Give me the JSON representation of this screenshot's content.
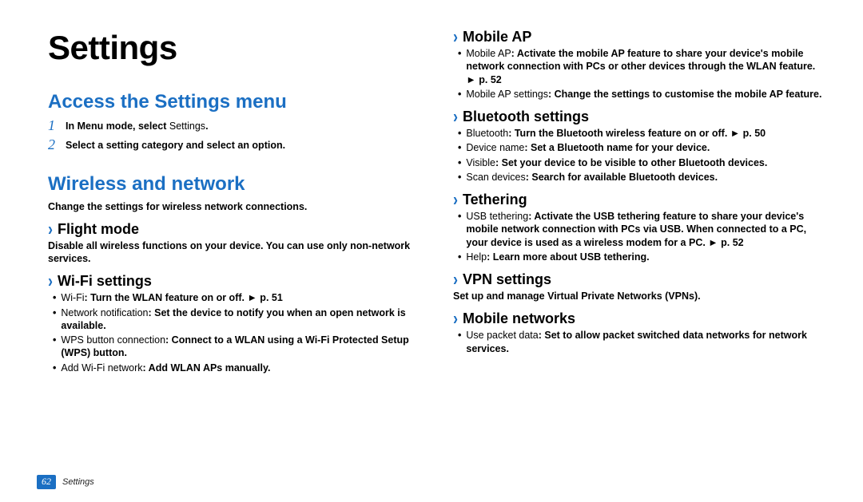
{
  "page": {
    "number": "62",
    "footer_label": "Settings"
  },
  "title": "Settings",
  "left": {
    "h2a": "Access the Settings menu",
    "step1_pre": "In Menu mode, select ",
    "step1_em": "Settings",
    "step1_post": ".",
    "step2": "Select a setting category and select an option.",
    "h2b": "Wireless and network",
    "intro": "Change the settings for wireless network connections.",
    "flight_h": "Flight mode",
    "flight_body": "Disable all wireless functions on your device. You can use only non-network services.",
    "wifi_h": "Wi-Fi settings",
    "wifi_b1_pre": "Wi-Fi",
    "wifi_b1_post": ": Turn the WLAN feature on or off. ► p. 51",
    "wifi_b2_pre": "Network notification",
    "wifi_b2_post": ": Set the device to notify you when an open network is available.",
    "wifi_b3_pre": "WPS button connection",
    "wifi_b3_post": ": Connect to a WLAN using a Wi-Fi Protected Setup (WPS) button.",
    "wifi_b4_pre": "Add Wi-Fi network",
    "wifi_b4_post": ": Add WLAN APs manually."
  },
  "right": {
    "map_h": "Mobile AP",
    "map_b1_pre": "Mobile AP",
    "map_b1_post": ": Activate the mobile AP feature to share your device's mobile network connection with PCs or other devices through the WLAN feature. ► p. 52",
    "map_b2_pre": "Mobile AP settings",
    "map_b2_post": ": Change the settings to customise the mobile AP feature.",
    "bt_h": "Bluetooth settings",
    "bt_b1_pre": "Bluetooth",
    "bt_b1_post": ": Turn the Bluetooth wireless feature on or off. ► p. 50",
    "bt_b2_pre": "Device name",
    "bt_b2_post": ": Set a Bluetooth name for your device.",
    "bt_b3_pre": "Visible",
    "bt_b3_post": ": Set your device to be visible to other Bluetooth devices.",
    "bt_b4_pre": "Scan devices",
    "bt_b4_post": ": Search for available Bluetooth devices.",
    "teth_h": "Tethering",
    "teth_b1_pre": "USB tethering",
    "teth_b1_post": ": Activate the USB tethering feature to share your device's mobile network connection with PCs via USB. When connected to a PC, your device is used as a wireless modem for a PC. ► p. 52",
    "teth_b2_pre": "Help",
    "teth_b2_post": ": Learn more about USB tethering.",
    "vpn_h": "VPN settings",
    "vpn_body": "Set up and manage Virtual Private Networks (VPNs).",
    "mn_h": "Mobile networks",
    "mn_b1_pre": "Use packet data",
    "mn_b1_post": ": Set to allow packet switched data networks for network services."
  }
}
